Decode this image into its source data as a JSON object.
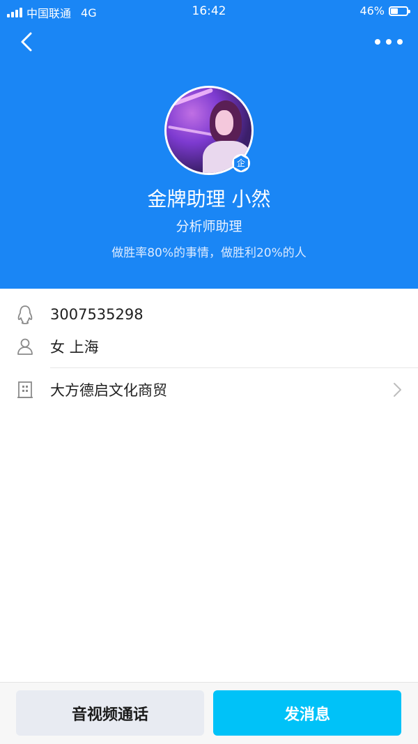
{
  "status_bar": {
    "carrier": "中国联通",
    "network": "4G",
    "time": "16:42",
    "battery": "46%",
    "battery_level": 0.46
  },
  "profile": {
    "name": "金牌助理 小然",
    "title": "分析师助理",
    "motto": "做胜率80%的事情，做胜利20%的人",
    "enterprise_badge": "企"
  },
  "info": {
    "qq": "3007535298",
    "gender_location": "女 上海",
    "company": "大方德启文化商贸"
  },
  "icons": {
    "back": "chevron-left-icon",
    "more": "more-dots-icon",
    "qq": "penguin-icon",
    "person": "person-icon",
    "company": "building-icon",
    "chevron": "chevron-right-icon"
  },
  "actions": {
    "call": "音视频通话",
    "message": "发消息"
  },
  "colors": {
    "header": "#1a86f5",
    "message_button": "#00c2f8",
    "call_button": "#e8ebf2"
  }
}
